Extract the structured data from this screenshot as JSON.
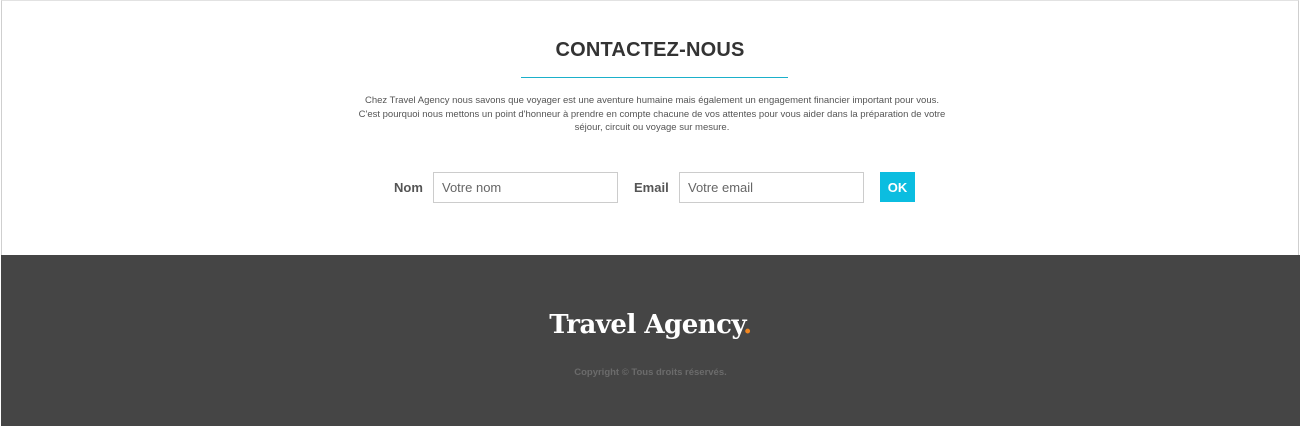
{
  "contact": {
    "title": "CONTACTEZ-NOUS",
    "intro_lines": [
      "Chez Travel Agency nous savons que voyager est une aventure humaine mais également un engagement financier important pour vous.",
      "C'est pourquoi nous mettons un point d'honneur à prendre en compte chacune de vos attentes pour vous aider dans la préparation de votre",
      "séjour, circuit ou voyage sur mesure."
    ],
    "form": {
      "name_label": "Nom",
      "name_placeholder": "Votre nom",
      "name_value": "",
      "email_label": "Email",
      "email_placeholder": "Votre email",
      "email_value": "",
      "submit_label": "OK"
    }
  },
  "footer": {
    "logo_text": "Travel Agency",
    "logo_dot": ".",
    "copyright": "Copyright © Tous droits réservés."
  },
  "colors": {
    "accent": "#0bbde0",
    "title_rule": "#1bb0ca",
    "footer_bg": "#454545",
    "logo_dot": "#f0851f"
  }
}
